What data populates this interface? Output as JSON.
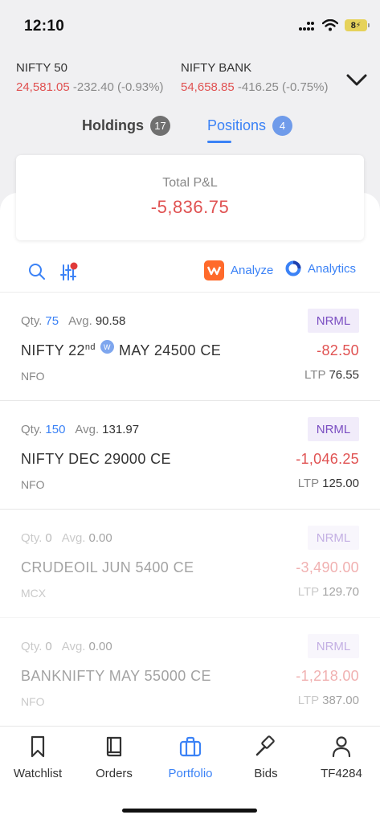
{
  "status_bar": {
    "time": "12:10",
    "battery": "8"
  },
  "ticker": [
    {
      "name": "NIFTY 50",
      "price": "24,581.05",
      "change": "-232.40 (-0.93%)"
    },
    {
      "name": "NIFTY BANK",
      "price": "54,658.85",
      "change": "-416.25 (-0.75%)"
    }
  ],
  "tabs": {
    "holdings": {
      "label": "Holdings",
      "count": "17"
    },
    "positions": {
      "label": "Positions",
      "count": "4"
    }
  },
  "pnl": {
    "label": "Total P&L",
    "value": "-5,836.75"
  },
  "toolbar": {
    "analyze_label": "Analyze",
    "analytics_label": "Analytics"
  },
  "positions": [
    {
      "qty_label": "Qty.",
      "qty": "75",
      "avg_label": "Avg.",
      "avg": "90.58",
      "product": "NRML",
      "symbol_prefix": "NIFTY 22",
      "symbol_suffix": "nd",
      "weekly_badge": "W",
      "symbol_rest": "MAY 24500 CE",
      "pnl": "-82.50",
      "exchange": "NFO",
      "ltp_label": "LTP",
      "ltp": "76.55"
    },
    {
      "qty_label": "Qty.",
      "qty": "150",
      "avg_label": "Avg.",
      "avg": "131.97",
      "product": "NRML",
      "symbol": "NIFTY DEC 29000 CE",
      "pnl": "-1,046.25",
      "exchange": "NFO",
      "ltp_label": "LTP",
      "ltp": "125.00"
    },
    {
      "qty_label": "Qty.",
      "qty": "0",
      "avg_label": "Avg.",
      "avg": "0.00",
      "product": "NRML",
      "symbol": "CRUDEOIL JUN 5400 CE",
      "pnl": "-3,490.00",
      "exchange": "MCX",
      "ltp_label": "LTP",
      "ltp": "129.70"
    },
    {
      "qty_label": "Qty.",
      "qty": "0",
      "avg_label": "Avg.",
      "avg": "0.00",
      "product": "NRML",
      "symbol": "BANKNIFTY MAY 55000 CE",
      "pnl": "-1,218.00",
      "exchange": "NFO",
      "ltp_label": "LTP",
      "ltp": "387.00"
    }
  ],
  "nav": [
    {
      "label": "Watchlist",
      "icon": "bookmark-icon"
    },
    {
      "label": "Orders",
      "icon": "book-icon"
    },
    {
      "label": "Portfolio",
      "icon": "briefcase-icon",
      "active": true
    },
    {
      "label": "Bids",
      "icon": "gavel-icon"
    },
    {
      "label": "TF4284",
      "icon": "user-icon"
    }
  ],
  "colors": {
    "accent": "#3b82f6",
    "loss": "#e05252",
    "product_badge": "#7b4fc2"
  }
}
